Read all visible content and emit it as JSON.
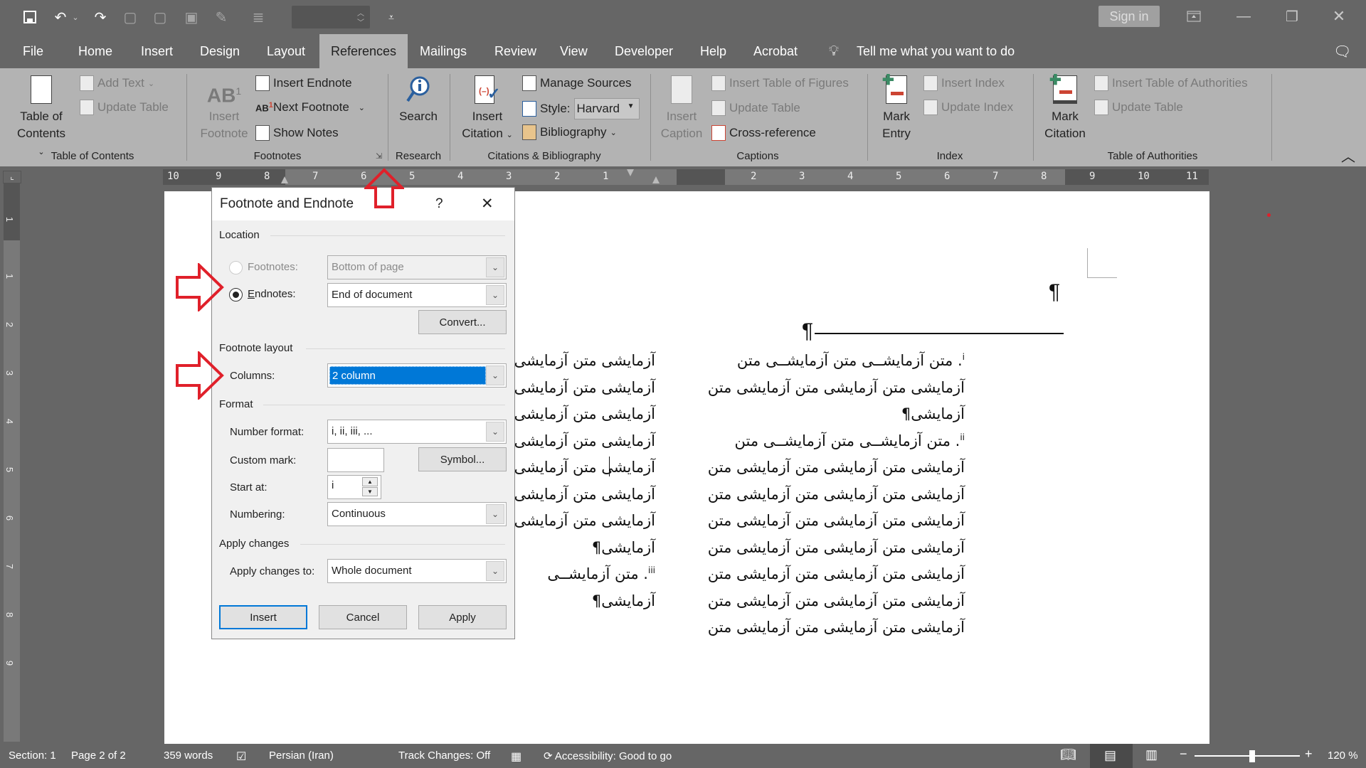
{
  "quick_access": {
    "save_icon": "save-icon",
    "undo_icon": "undo-icon",
    "redo_icon": "redo-icon",
    "customize_icon": "customize-qat-icon"
  },
  "window": {
    "sign_in": "Sign in",
    "ribbon_display_icon": "ribbon-display-options-icon",
    "minimize_icon": "minimize-icon",
    "restore_icon": "restore-icon",
    "close_icon": "close-icon"
  },
  "tabs": [
    {
      "label": "File"
    },
    {
      "label": "Home"
    },
    {
      "label": "Insert"
    },
    {
      "label": "Design"
    },
    {
      "label": "Layout"
    },
    {
      "label": "References",
      "active": true
    },
    {
      "label": "Mailings"
    },
    {
      "label": "Review"
    },
    {
      "label": "View"
    },
    {
      "label": "Developer"
    },
    {
      "label": "Help"
    },
    {
      "label": "Acrobat"
    }
  ],
  "tell_me": "Tell me what you want to do",
  "ribbon": {
    "toc": {
      "table_of_contents_line1": "Table of",
      "table_of_contents_line2": "Contents",
      "add_text": "Add Text",
      "update_table": "Update Table",
      "group_label": "Table of Contents"
    },
    "footnotes": {
      "insert_footnote_glyph": "AB",
      "insert_footnote_line1": "Insert",
      "insert_footnote_line2": "Footnote",
      "insert_endnote": "Insert Endnote",
      "next_footnote": "Next Footnote",
      "show_notes": "Show Notes",
      "group_label": "Footnotes"
    },
    "research": {
      "search": "Search",
      "group_label": "Research"
    },
    "citations": {
      "insert_citation_line1": "Insert",
      "insert_citation_line2": "Citation",
      "manage_sources": "Manage Sources",
      "style_label": "Style:",
      "style_value": "Harvard",
      "bibliography": "Bibliography",
      "group_label": "Citations & Bibliography"
    },
    "captions": {
      "insert_caption_line1": "Insert",
      "insert_caption_line2": "Caption",
      "insert_table_of_figures": "Insert Table of Figures",
      "update_table": "Update Table",
      "cross_reference": "Cross-reference",
      "group_label": "Captions"
    },
    "index": {
      "mark_entry_line1": "Mark",
      "mark_entry_line2": "Entry",
      "insert_index": "Insert Index",
      "update_index": "Update Index",
      "group_label": "Index"
    },
    "authorities": {
      "mark_citation_line1": "Mark",
      "mark_citation_line2": "Citation",
      "insert_table_of_authorities": "Insert Table of Authorities",
      "update_table": "Update Table",
      "group_label": "Table of Authorities"
    }
  },
  "ruler": {
    "left_numbers": [
      "10",
      "9",
      "8",
      "7",
      "6",
      "5",
      "4",
      "3",
      "2",
      "1"
    ],
    "right_numbers": [
      "2",
      "3",
      "4",
      "5",
      "6",
      "7",
      "8",
      "9",
      "10",
      "11"
    ],
    "vertical_numbers": [
      "1",
      "1",
      "2",
      "3",
      "4",
      "5",
      "6",
      "7",
      "8",
      "9"
    ]
  },
  "dialog": {
    "title": "Footnote and Endnote",
    "help": "?",
    "location_section": "Location",
    "footnotes_label": "Footnotes:",
    "footnotes_value": "Bottom of page",
    "footnotes_selected": false,
    "endnotes_label": "Endnotes:",
    "endnotes_value": "End of document",
    "endnotes_selected": true,
    "convert_button": "Convert...",
    "layout_section": "Footnote layout",
    "columns_label": "Columns:",
    "columns_value": "2 column",
    "format_section": "Format",
    "number_format_label": "Number format:",
    "number_format_value": "i, ii, iii, ...",
    "custom_mark_label": "Custom mark:",
    "custom_mark_value": "",
    "symbol_button": "Symbol...",
    "start_at_label": "Start at:",
    "start_at_value": "i",
    "numbering_label": "Numbering:",
    "numbering_value": "Continuous",
    "apply_section": "Apply changes",
    "apply_to_label": "Apply changes to:",
    "apply_to_value": "Whole document",
    "insert_button": "Insert",
    "cancel_button": "Cancel",
    "apply_button": "Apply"
  },
  "document": {
    "pilcrow": "¶",
    "right_column": [
      {
        "text": ". متن آزمایشــی متن آزمایشــی متن",
        "note": "i"
      },
      {
        "text": "آزمایشی متن آزمایشی متن آزمایشی متن"
      },
      {
        "text": "آزمایشی¶"
      },
      {
        "text": ". متن آزمایشــی متن آزمایشــی متن",
        "note": "ii"
      },
      {
        "text": "آزمایشی متن آزمایشی متن آزمایشی متن"
      },
      {
        "text": "آزمایشی متن آزمایشی متن آزمایشی متن"
      },
      {
        "text": "آزمایشی متن آزمایشی متن آزمایشی متن"
      },
      {
        "text": "آزمایشی متن آزمایشی متن آزمایشی متن"
      },
      {
        "text": "آزمایشی متن آزمایشی متن آزمایشی متن"
      },
      {
        "text": "آزمایشی متن آزمایشی متن آزمایشی متن"
      },
      {
        "text": "آزمایشی متن آزمایشی متن آزمایشی متن"
      }
    ],
    "left_column": [
      {
        "text": "آزمایشی متن آزمایشی"
      },
      {
        "text": "آزمایشی متن آزمایشی"
      },
      {
        "text": "آزمایشی متن آزمایشی"
      },
      {
        "text": "آزمایشی متن آزمایشی"
      },
      {
        "text": "آزمایشی متن آزمایشی"
      },
      {
        "text": "آزمایشی متن آزمایشی"
      },
      {
        "text": "آزمایشی متن آزمایشی"
      },
      {
        "text": "آزمایشی¶"
      },
      {
        "text": ". متن آزمایشــی",
        "note": "iii"
      },
      {
        "text": "آزمایشی¶"
      }
    ]
  },
  "status_bar": {
    "section": "Section: 1",
    "page": "Page 2 of 2",
    "words": "359 words",
    "language": "Persian (Iran)",
    "track_changes": "Track Changes: Off",
    "accessibility": "Accessibility: Good to go",
    "zoom_minus": "−",
    "zoom_plus": "+",
    "zoom_level": "120 %",
    "zoom_fraction": 0.55
  },
  "colors": {
    "accent_red": "#e0202a",
    "selection_blue": "#0078d7"
  }
}
